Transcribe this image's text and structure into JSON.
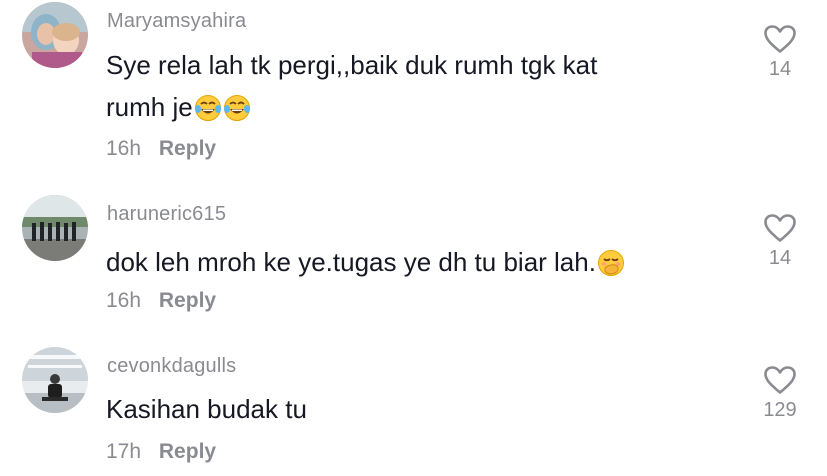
{
  "comments": [
    {
      "username": "Maryamsyahira",
      "text_line1": "Sye rela lah tk pergi,,baik duk rumh tgk kat",
      "text_line2": "rumh je",
      "emoji": [
        "face-with-tears-of-joy",
        "face-with-tears-of-joy"
      ],
      "time": "16h",
      "reply_label": "Reply",
      "likes": "14",
      "like_icon": "heart-outline-icon"
    },
    {
      "username": "haruneric615",
      "text_line1": "dok leh mroh ke ye.tugas ye dh tu biar lah.",
      "emoji": [
        "face-with-hand-over-mouth"
      ],
      "time": "16h",
      "reply_label": "Reply",
      "likes": "14",
      "like_icon": "heart-outline-icon"
    },
    {
      "username": "cevonkdagulls",
      "text_line1": "Kasihan budak tu",
      "time": "17h",
      "reply_label": "Reply",
      "likes": "129",
      "like_icon": "heart-outline-icon"
    }
  ],
  "colors": {
    "text": "#161823",
    "secondary": "#8a8b91",
    "background": "#ffffff"
  }
}
